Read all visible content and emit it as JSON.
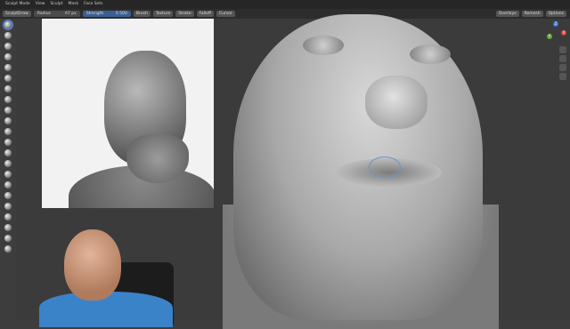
{
  "menubar": {
    "items": [
      "Sculpt Mode",
      "View",
      "Sculpt",
      "Mask",
      "Face Sets"
    ]
  },
  "header": {
    "mode_label": "SculptDraw",
    "radius_label": "Radius",
    "radius_value": "67 px",
    "strength_label": "Strength",
    "strength_value": "0.500",
    "menus": [
      "Brush",
      "Texture",
      "Stroke",
      "Falloff",
      "Cursor"
    ],
    "right_items": [
      "Overlays",
      "Remesh",
      "Options"
    ]
  },
  "toolbar": {
    "tool_count": 22,
    "active_tool": 0
  },
  "gizmo": {
    "axes": [
      "X",
      "Y",
      "Z"
    ]
  },
  "colors": {
    "active_blue": "#3c5f93",
    "viewport_bg": "#3b3b3b",
    "header_bg": "#2d2d2d"
  }
}
